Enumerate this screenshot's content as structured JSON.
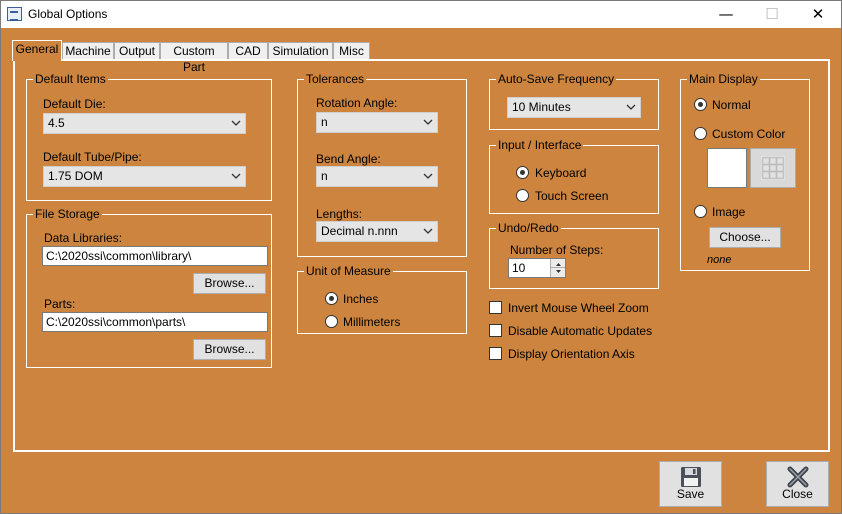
{
  "window": {
    "title": "Global Options",
    "minimize": "—",
    "maximize": "☐",
    "close": "✕"
  },
  "tabs": [
    "General",
    "Machine",
    "Output",
    "Custom Part",
    "CAD",
    "Simulation",
    "Misc"
  ],
  "default_items": {
    "title": "Default Items",
    "die_label": "Default Die:",
    "die_value": "4.5",
    "tube_label": "Default Tube/Pipe:",
    "tube_value": "1.75 DOM"
  },
  "file_storage": {
    "title": "File Storage",
    "libraries_label": "Data Libraries:",
    "libraries_value": "C:\\2020ssi\\common\\library\\",
    "browse1": "Browse...",
    "parts_label": "Parts:",
    "parts_value": "C:\\2020ssi\\common\\parts\\",
    "browse2": "Browse..."
  },
  "tolerances": {
    "title": "Tolerances",
    "rotation_label": "Rotation Angle:",
    "rotation_value": "n",
    "bend_label": "Bend Angle:",
    "bend_value": "n",
    "lengths_label": "Lengths:",
    "lengths_value": "Decimal n.nnn"
  },
  "unit_of_measure": {
    "title": "Unit of Measure",
    "inches": "Inches",
    "millimeters": "Millimeters",
    "selected": "Inches"
  },
  "auto_save": {
    "title": "Auto-Save Frequency",
    "value": "10 Minutes"
  },
  "input_interface": {
    "title": "Input / Interface",
    "keyboard": "Keyboard",
    "touch": "Touch Screen",
    "selected": "Keyboard"
  },
  "undo_redo": {
    "title": "Undo/Redo",
    "steps_label": "Number of Steps:",
    "steps_value": "10"
  },
  "checkboxes": {
    "invert_zoom": "Invert Mouse Wheel Zoom",
    "disable_updates": "Disable Automatic Updates",
    "display_axis": "Display Orientation Axis"
  },
  "main_display": {
    "title": "Main Display",
    "normal": "Normal",
    "custom_color": "Custom Color",
    "image": "Image",
    "choose": "Choose...",
    "image_value": "none",
    "selected": "Normal"
  },
  "footer": {
    "save": "Save",
    "close": "Close"
  },
  "colors": {
    "background": "#cd843e",
    "border": "#ffffff"
  }
}
